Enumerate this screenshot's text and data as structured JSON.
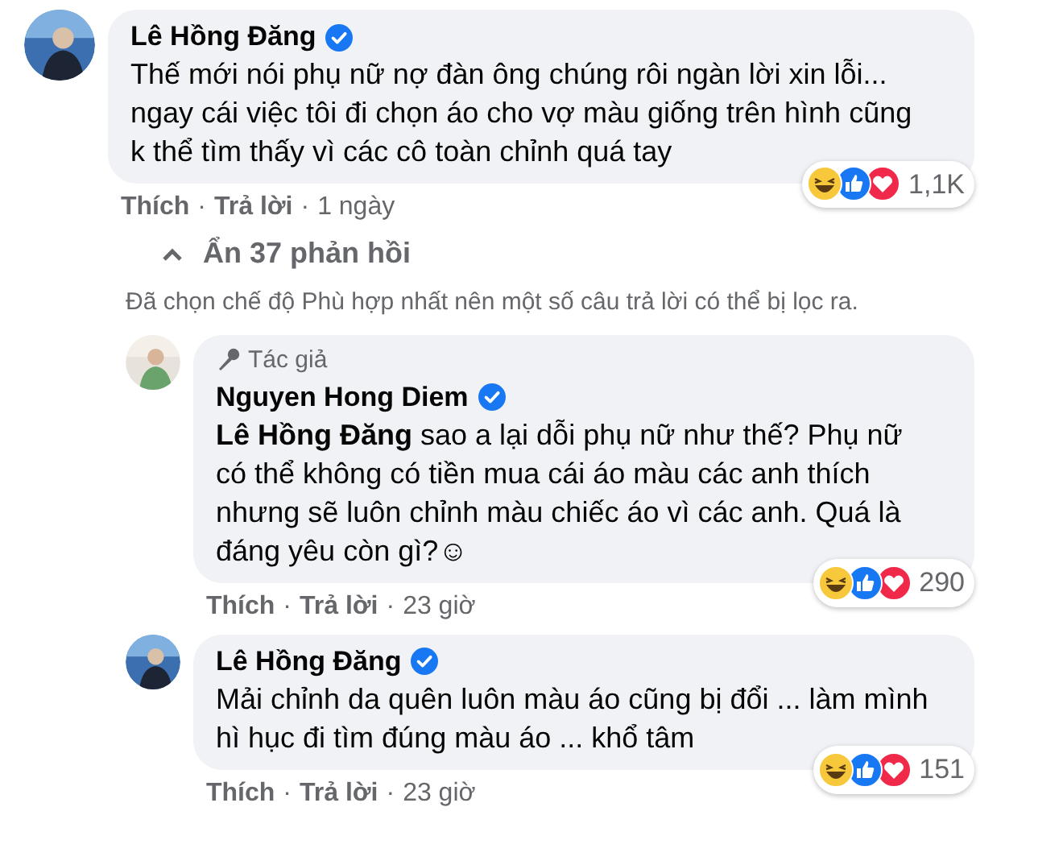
{
  "comment": {
    "author": "Lê Hồng Đăng",
    "verified": true,
    "text": "Thế mới nói phụ nữ nợ đàn ông chúng rôi ngàn lời xin lỗi... ngay cái việc tôi đi chọn áo cho vợ màu giống trên hình cũng k thể tìm thấy vì các cô toàn chỉnh quá tay",
    "actions": [
      "Thích",
      "Trả lời"
    ],
    "time": "1 ngày",
    "reaction_count": "1,1K"
  },
  "replies_toggle": {
    "label": "Ẩn 37 phản hồi",
    "expanded": true
  },
  "separator": "·",
  "filter_note": "Đã chọn chế độ Phù hợp nhất nên một số câu trả lời có thể bị lọc ra.",
  "replies": [
    {
      "badge": "Tác giả",
      "author": "Nguyen Hong Diem",
      "verified": true,
      "text": "**Lê Hồng Đăng** sao a lại dỗi phụ nữ như thế? Phụ nữ có thể không có tiền mua cái áo màu các anh thích nhưng sẽ luôn chỉnh màu chiếc áo vì các anh. Quá là đáng yêu còn gì?☺",
      "actions": [
        "Thích",
        "Trả lời"
      ],
      "time": "23 giờ",
      "reaction_count": "290"
    },
    {
      "author": "Lê Hồng Đăng",
      "verified": true,
      "text": "Mải chỉnh da quên luôn màu áo cũng bị đổi ... làm mình hì hục đi tìm đúng màu áo ... khổ tâm",
      "actions": [
        "Thích",
        "Trả lời"
      ],
      "time": "23 giờ",
      "reaction_count": "151"
    }
  ]
}
